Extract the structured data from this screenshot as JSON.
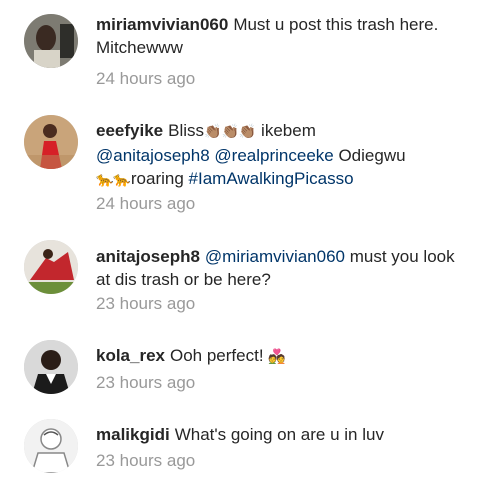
{
  "comments": [
    {
      "username": "miriamvivian060",
      "text": "Must u post this trash here. Mitchewww",
      "time": "24 hours ago"
    },
    {
      "username": "eeefyike",
      "text_before": "Bliss",
      "emoji_group_1": "👏🏽👏🏽👏🏽",
      "text_middle": " ikebem",
      "mention_1": "@anitajoseph8",
      "mention_2": "@realprinceeke",
      "text_after_mentions": " Odiegwu",
      "emoji_group_2": "🐆🐆",
      "text_roaring": "roaring",
      "hashtag": "#IamAwalkingPicasso",
      "time": "24 hours ago"
    },
    {
      "username": "anitajoseph8",
      "mention": "@miriamvivian060",
      "text": "must you look at dis trash or be here?",
      "time": "23 hours ago"
    },
    {
      "username": "kola_rex",
      "text": "Ooh perfect!",
      "emoji": "💑",
      "time": "23 hours ago"
    },
    {
      "username": "malikgidi",
      "text": "What's going on are u in luv",
      "time": "23 hours ago"
    }
  ]
}
